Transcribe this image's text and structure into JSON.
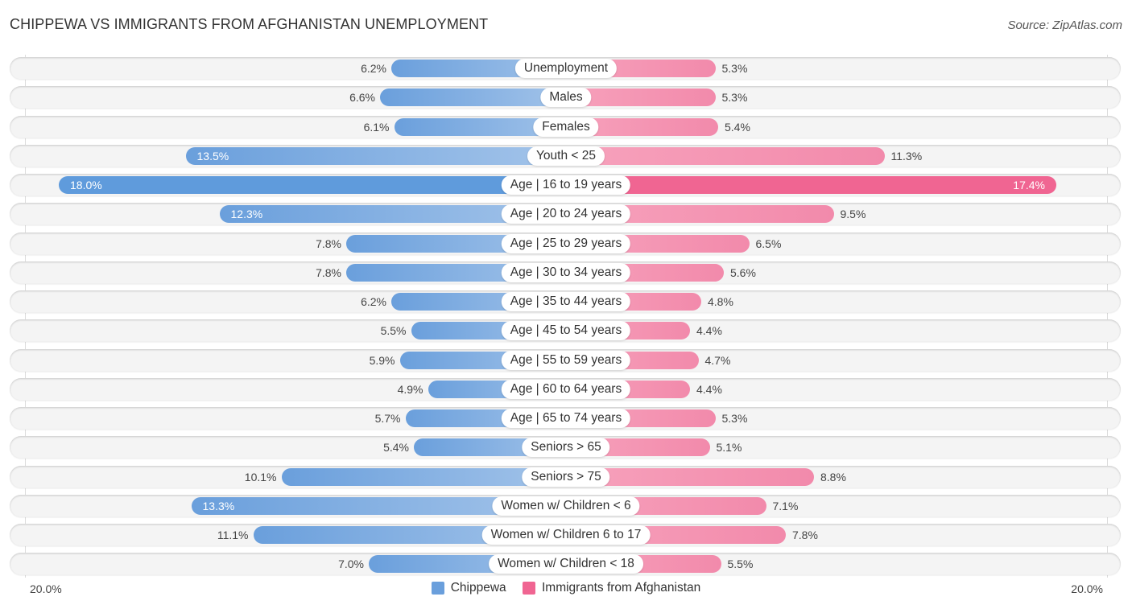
{
  "title": "CHIPPEWA VS IMMIGRANTS FROM AFGHANISTAN UNEMPLOYMENT",
  "source": "Source: ZipAtlas.com",
  "colors": {
    "chippewa": "#6a9fdc",
    "afghanistan": "#f06592"
  },
  "chart_data": {
    "type": "bar",
    "orientation": "horizontal-diverging",
    "title": "CHIPPEWA VS IMMIGRANTS FROM AFGHANISTAN UNEMPLOYMENT",
    "xlabel": "",
    "ylabel": "",
    "xlim": [
      -20,
      20
    ],
    "axis_ticks": {
      "left": "20.0%",
      "right": "20.0%"
    },
    "grid": false,
    "legend_position": "bottom-center",
    "categories": [
      "Unemployment",
      "Males",
      "Females",
      "Youth < 25",
      "Age | 16 to 19 years",
      "Age | 20 to 24 years",
      "Age | 25 to 29 years",
      "Age | 30 to 34 years",
      "Age | 35 to 44 years",
      "Age | 45 to 54 years",
      "Age | 55 to 59 years",
      "Age | 60 to 64 years",
      "Age | 65 to 74 years",
      "Seniors > 65",
      "Seniors > 75",
      "Women w/ Children < 6",
      "Women w/ Children 6 to 17",
      "Women w/ Children < 18"
    ],
    "series": [
      {
        "name": "Chippewa",
        "side": "left",
        "values": [
          6.2,
          6.6,
          6.1,
          13.5,
          18.0,
          12.3,
          7.8,
          7.8,
          6.2,
          5.5,
          5.9,
          4.9,
          5.7,
          5.4,
          10.1,
          13.3,
          11.1,
          7.0
        ],
        "labels": [
          "6.2%",
          "6.6%",
          "6.1%",
          "13.5%",
          "18.0%",
          "12.3%",
          "7.8%",
          "7.8%",
          "6.2%",
          "5.5%",
          "5.9%",
          "4.9%",
          "5.7%",
          "5.4%",
          "10.1%",
          "13.3%",
          "11.1%",
          "7.0%"
        ]
      },
      {
        "name": "Immigrants from Afghanistan",
        "side": "right",
        "values": [
          5.3,
          5.3,
          5.4,
          11.3,
          17.4,
          9.5,
          6.5,
          5.6,
          4.8,
          4.4,
          4.7,
          4.4,
          5.3,
          5.1,
          8.8,
          7.1,
          7.8,
          5.5
        ],
        "labels": [
          "5.3%",
          "5.3%",
          "5.4%",
          "11.3%",
          "17.4%",
          "9.5%",
          "6.5%",
          "5.6%",
          "4.8%",
          "4.4%",
          "4.7%",
          "4.4%",
          "5.3%",
          "5.1%",
          "8.8%",
          "7.1%",
          "7.8%",
          "5.5%"
        ]
      }
    ]
  },
  "legend": [
    {
      "label": "Chippewa",
      "color": "#6a9fdc"
    },
    {
      "label": "Immigrants from Afghanistan",
      "color": "#f06592"
    }
  ]
}
